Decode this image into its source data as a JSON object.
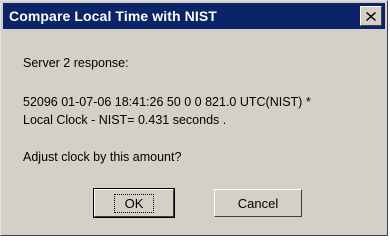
{
  "window": {
    "title": "Compare Local Time with NIST"
  },
  "message": {
    "heading": "Server 2 response:",
    "response_line": "52096 01-07-06 18:41:26 50 0 0 821.0 UTC(NIST) *",
    "offset_line": "Local Clock - NIST= 0.431 seconds .",
    "question": "Adjust clock by this amount?"
  },
  "buttons": {
    "ok_label": "OK",
    "cancel_label": "Cancel"
  },
  "icons": {
    "close": "close-icon"
  },
  "colors": {
    "titlebar": "#0a246a",
    "face": "#d4d0c8"
  }
}
